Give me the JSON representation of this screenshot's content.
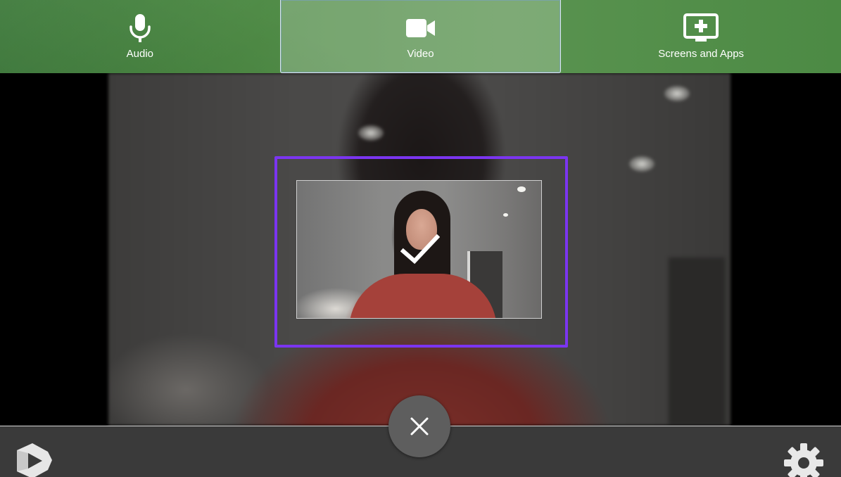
{
  "source_tabs": {
    "audio": {
      "label": "Audio",
      "icon": "microphone-icon"
    },
    "video": {
      "label": "Video",
      "icon": "video-camera-icon",
      "selected": true
    },
    "screens": {
      "label": "Screens and Apps",
      "icon": "screen-share-icon"
    }
  },
  "preview": {
    "selected": true,
    "status_icon": "checkmark-icon",
    "frame_color": "#7b35f0"
  },
  "controls": {
    "close_icon": "close-icon",
    "settings_icon": "gear-icon",
    "logo_icon": "app-logo-icon"
  },
  "colors": {
    "header_green": "#4e8a45",
    "bottom_bar": "#3a3a3a",
    "accent_purple": "#7b35f0"
  }
}
